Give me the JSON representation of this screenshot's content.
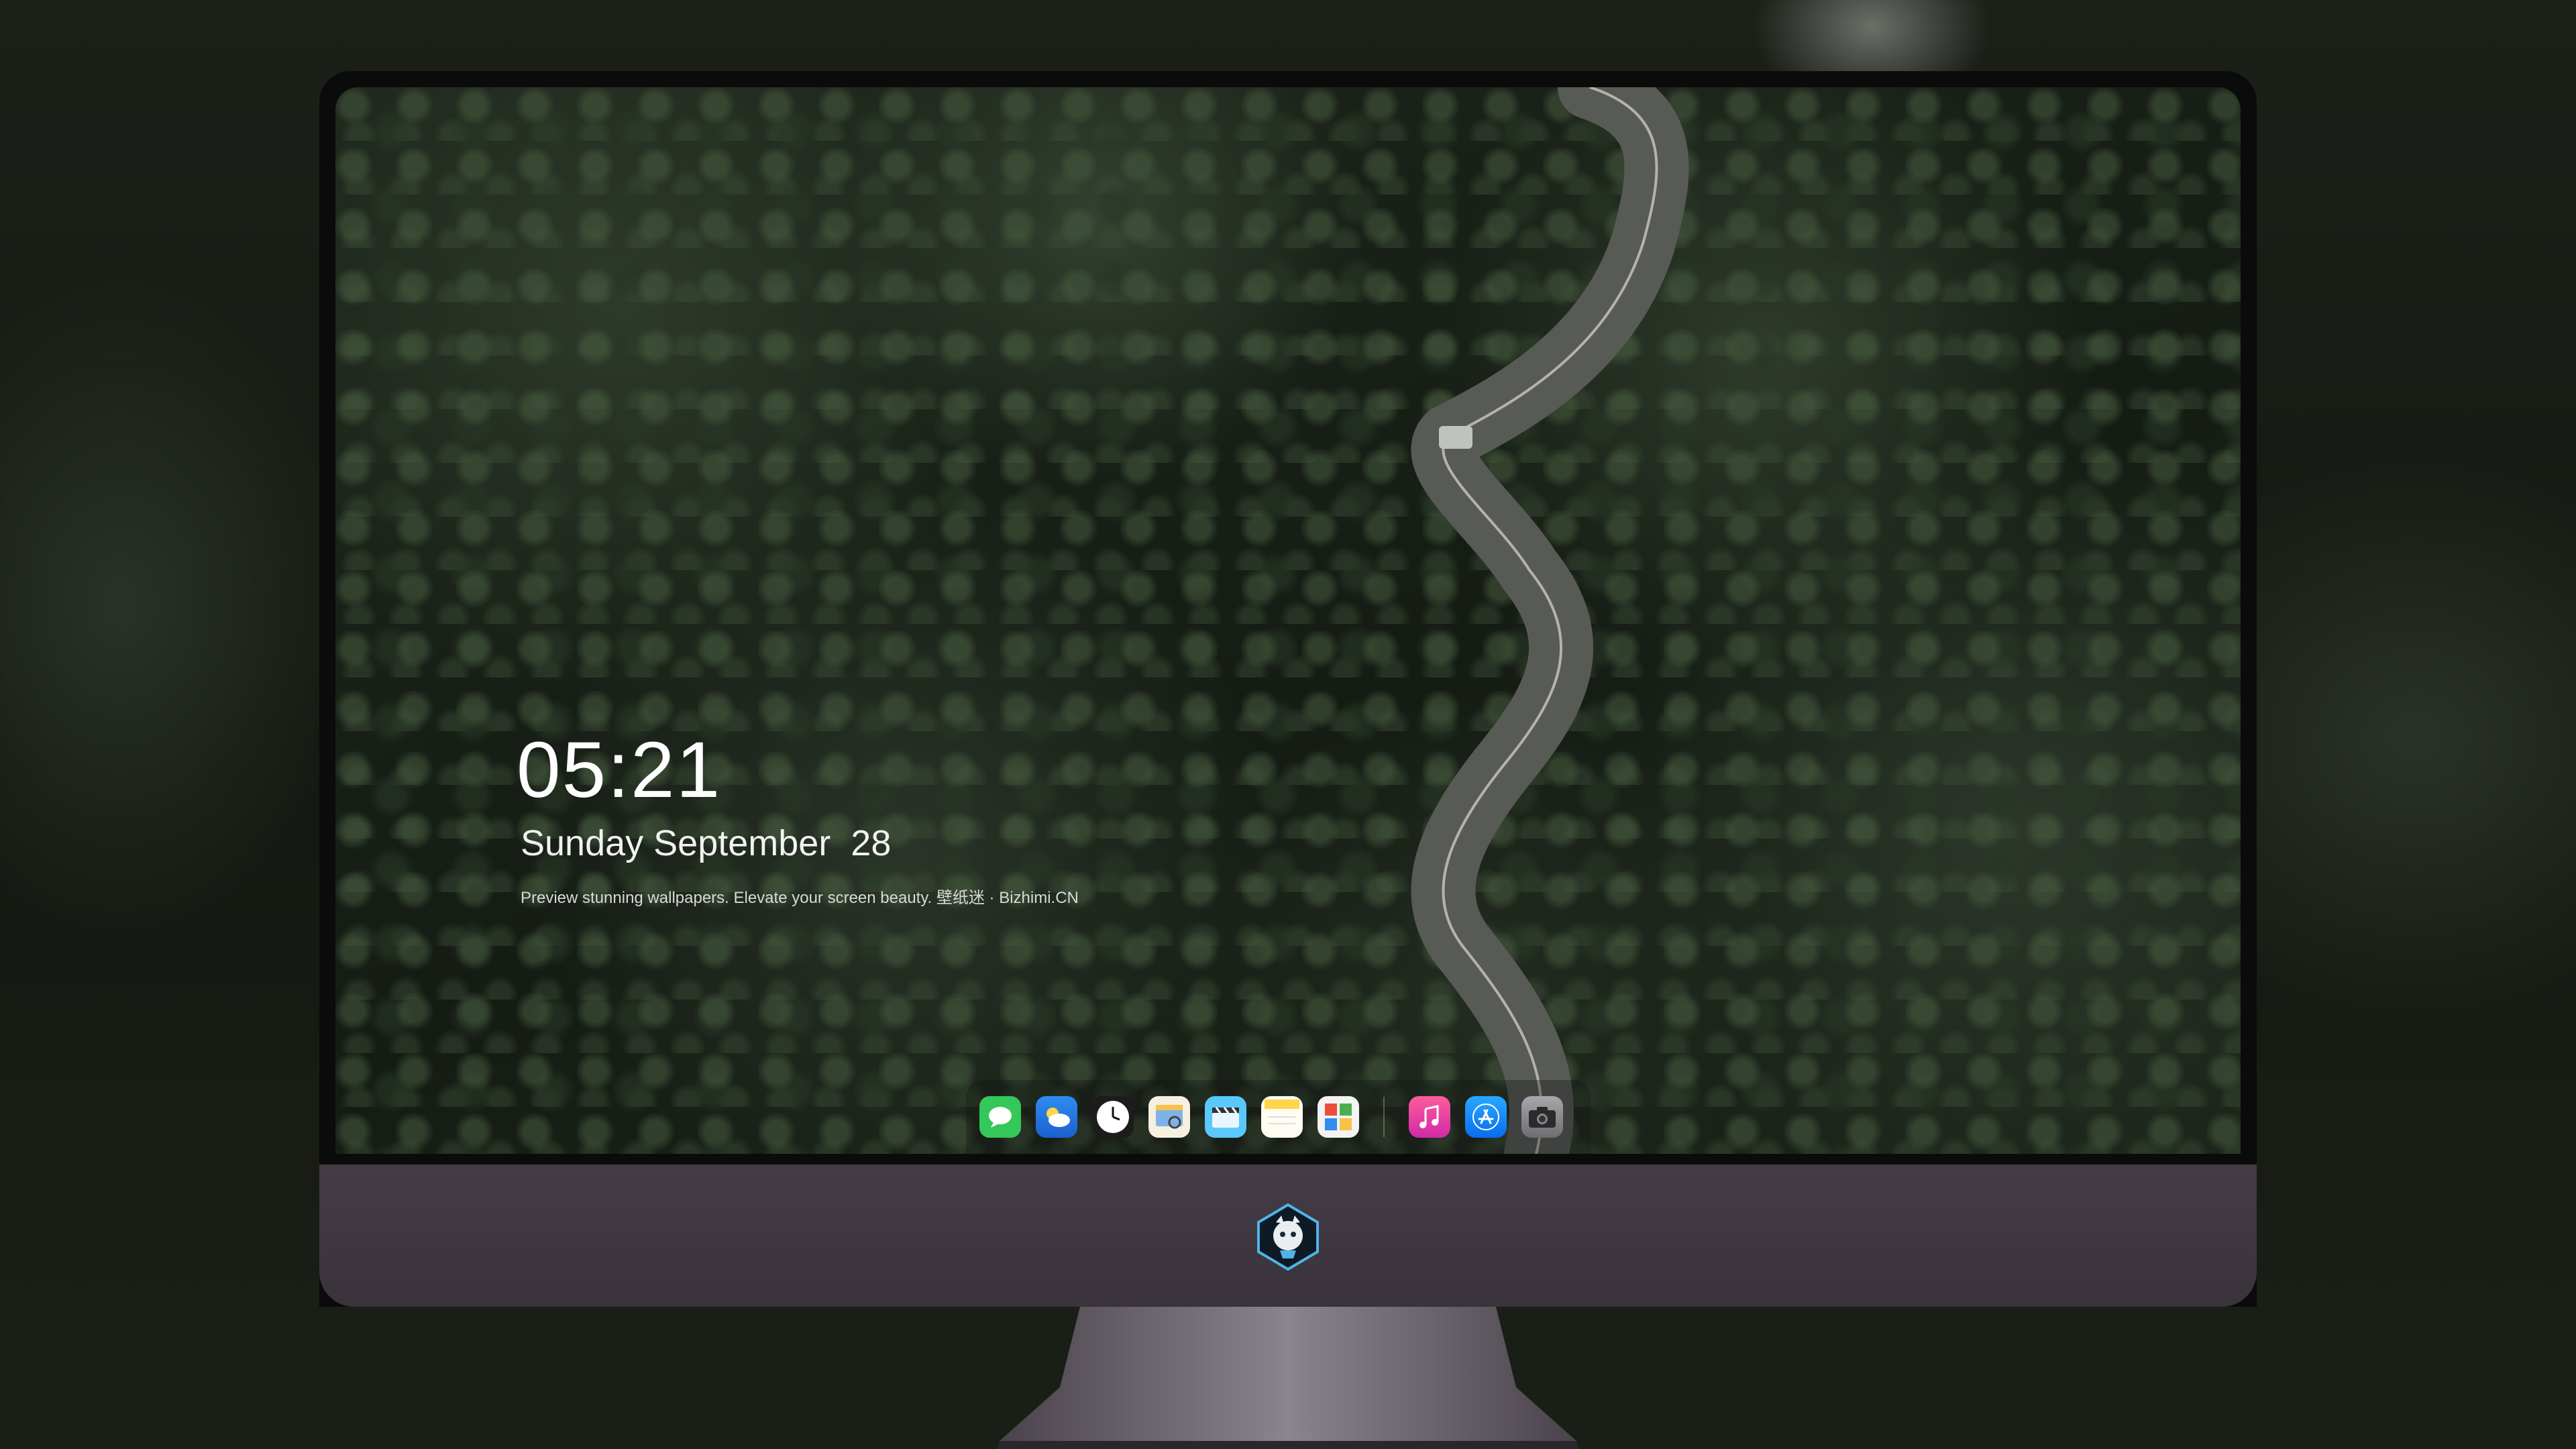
{
  "lockscreen": {
    "time": "05:21",
    "date": "Sunday September  28",
    "tagline": "Preview stunning wallpapers. Elevate your screen beauty. 壁纸迷 · Bizhimi.CN"
  },
  "dock": {
    "apps": [
      {
        "name": "Messages",
        "icon": "messages-icon",
        "color": "#34c759"
      },
      {
        "name": "Weather",
        "icon": "weather-icon",
        "color": "#1e88e5"
      },
      {
        "name": "Clock",
        "icon": "clock-icon",
        "color": "#ffffff"
      },
      {
        "name": "Preview",
        "icon": "preview-icon",
        "color": "#f5c24a"
      },
      {
        "name": "Clips",
        "icon": "clips-icon",
        "color": "#5ac8fa"
      },
      {
        "name": "Notes",
        "icon": "notes-icon",
        "color": "#ffd54a"
      },
      {
        "name": "Photo Booth",
        "icon": "photos-icon",
        "color": "#e94e3d"
      },
      {
        "name": "Music",
        "icon": "music-icon",
        "color": "#fc3c8c"
      },
      {
        "name": "App Store",
        "icon": "app-store-icon",
        "color": "#0a84ff"
      },
      {
        "name": "Camera",
        "icon": "camera-icon",
        "color": "#8e8e93"
      }
    ]
  },
  "colors": {
    "chin": "#3f373f",
    "bezel": "#0b0b0b",
    "forest": "#1d251b",
    "road": "#5e605c"
  }
}
